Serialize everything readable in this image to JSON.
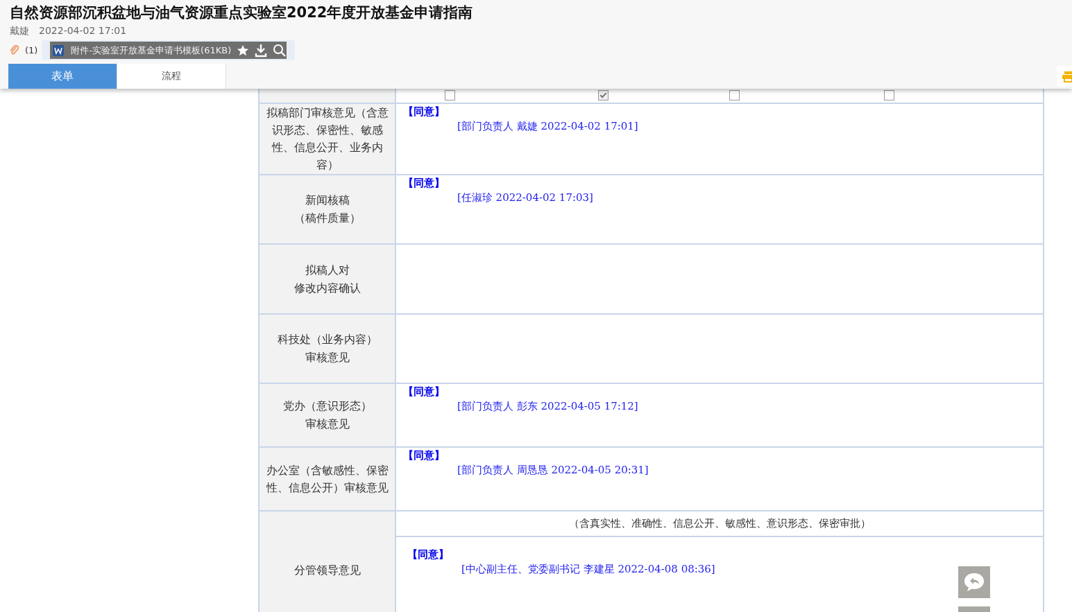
{
  "header": {
    "title": "自然资源部沉积盆地与油气资源重点实验室2022年度开放基金申请指南",
    "author": "戴婕",
    "date": "2022-04-02 17:01",
    "attachment": {
      "count": "(1)",
      "file_name": "附件-实验室开放基金申请书模板(61KB)"
    }
  },
  "tabs": [
    {
      "label": "表单",
      "selected": true
    },
    {
      "label": "流程",
      "selected": false
    }
  ],
  "form": {
    "publish_options": [
      {
        "checked": false
      },
      {
        "checked": true
      },
      {
        "checked": false
      },
      {
        "checked": false
      }
    ],
    "rows": [
      {
        "label": [
          "拟稿部门审核意见（含意识形态、保密性、敏感性、信息公开、业务内容）"
        ],
        "opinions": [
          {
            "verdict": "【同意】",
            "signature": "[部门负责人 戴婕 2022-04-02 17:01]"
          }
        ]
      },
      {
        "label": [
          "新闻核稿",
          "（稿件质量）"
        ],
        "opinions": [
          {
            "verdict": "【同意】",
            "signature": "[任淑珍 2022-04-02 17:03]"
          }
        ]
      },
      {
        "label": [
          "拟稿人对",
          "修改内容确认"
        ],
        "opinions": []
      },
      {
        "label": [
          "科技处（业务内容）",
          "审核意见"
        ],
        "opinions": []
      },
      {
        "label": [
          "党办（意识形态）",
          "审核意见"
        ],
        "opinions": [
          {
            "verdict": "【同意】",
            "signature": "[部门负责人 彭东 2022-04-05 17:12]"
          }
        ]
      },
      {
        "label": [
          "办公室（含敏感性、保密性、信息公开）审核意见"
        ],
        "opinions": [
          {
            "verdict": "【同意】",
            "signature": "[部门负责人 周恳恳 2022-04-05 20:31]"
          }
        ]
      },
      {
        "label": [
          "分管领导意见"
        ],
        "note": "（含真实性、准确性、信息公开、敏感性、意识形态、保密审批）",
        "opinions": [
          {
            "verdict": "【同意】",
            "signature": "[中心副主任、党委副书记 李建星 2022-04-08 08:36]"
          }
        ]
      }
    ]
  }
}
